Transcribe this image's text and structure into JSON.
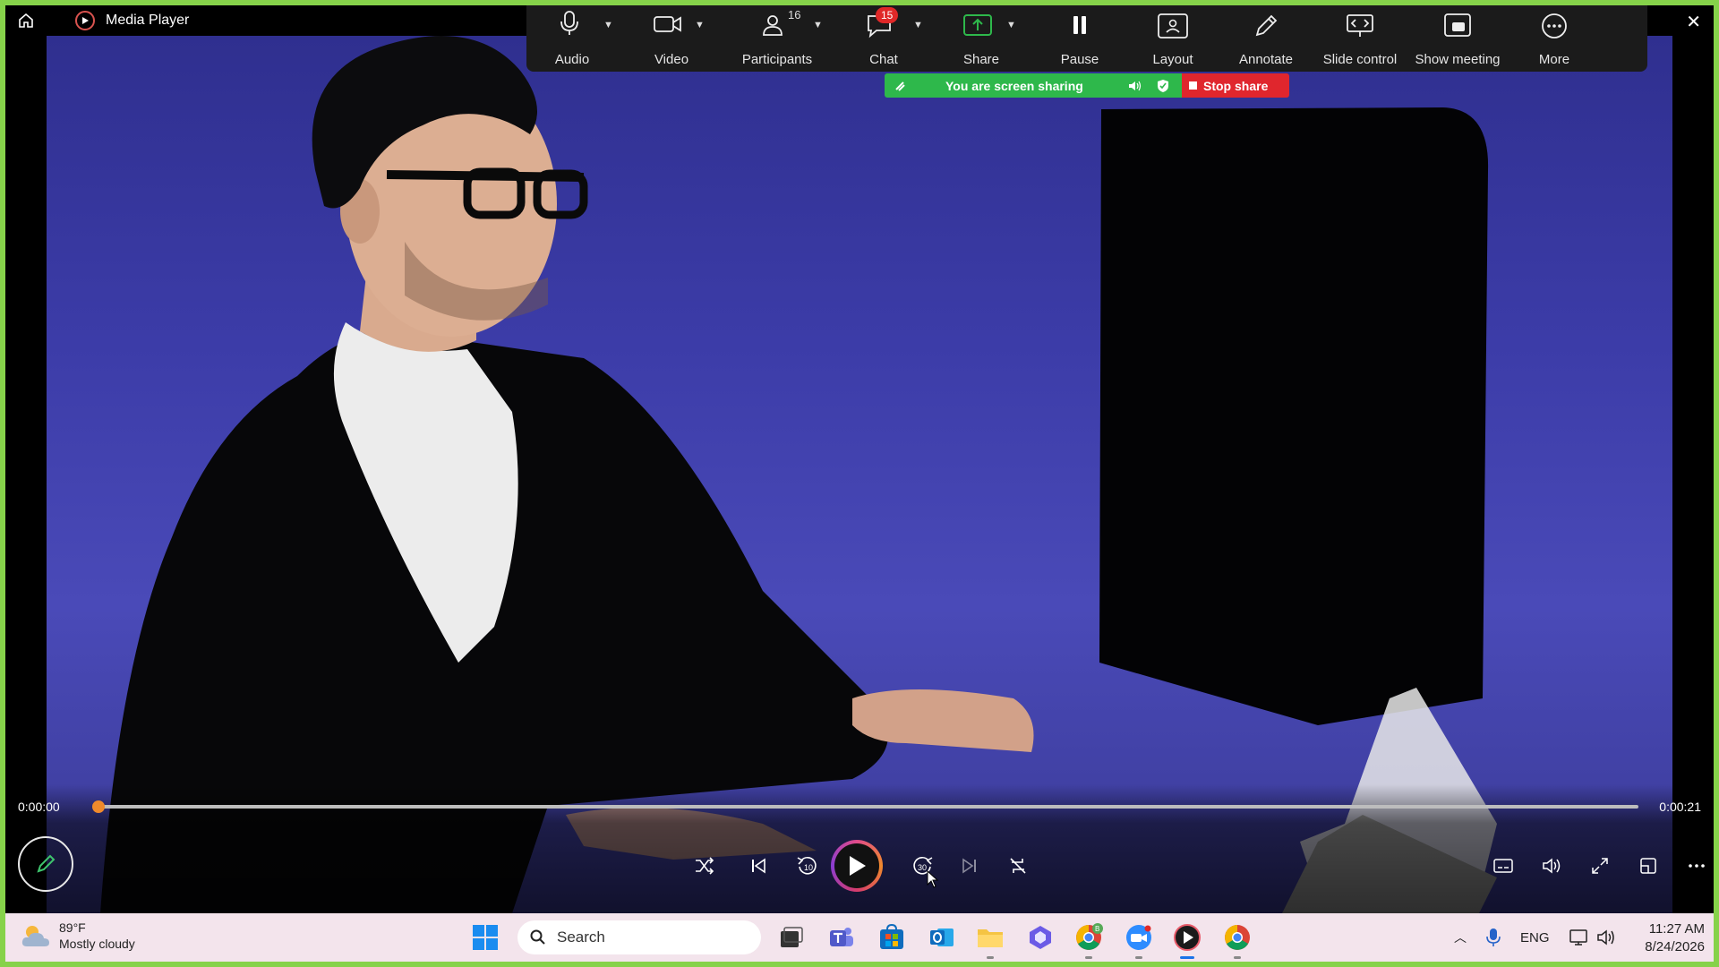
{
  "window": {
    "title": "Media Player"
  },
  "zoom_toolbar": {
    "items": [
      {
        "label": "Audio",
        "icon": "microphone-icon"
      },
      {
        "label": "Video",
        "icon": "video-camera-icon"
      },
      {
        "label": "Participants",
        "icon": "participants-icon",
        "count": "16"
      },
      {
        "label": "Chat",
        "icon": "chat-icon",
        "badge": "15"
      },
      {
        "label": "Share",
        "icon": "share-screen-icon"
      },
      {
        "label": "Pause",
        "icon": "pause-icon"
      },
      {
        "label": "Layout",
        "icon": "layout-icon"
      },
      {
        "label": "Annotate",
        "icon": "pencil-icon"
      },
      {
        "label": "Slide control",
        "icon": "slide-control-icon"
      },
      {
        "label": "Show meeting",
        "icon": "show-meeting-icon"
      },
      {
        "label": "More",
        "icon": "more-icon"
      }
    ]
  },
  "share_banner": {
    "status": "You are screen sharing",
    "stop_label": "Stop share",
    "status_color": "#2eb84b",
    "stop_color": "#e0262d"
  },
  "playback": {
    "current_time": "0:00:00",
    "total_time": "0:00:21",
    "progress_fraction": 0.0,
    "rewind_label": "10",
    "forward_label": "30",
    "accent": "#f08a2c"
  },
  "taskbar": {
    "weather": {
      "temp": "89°F",
      "condition": "Mostly cloudy"
    },
    "search_placeholder": "Search",
    "tray": {
      "language": "ENG"
    },
    "clock": {
      "time": "11:27 AM",
      "date": "8/24/2026"
    },
    "chrome_badge": "B"
  }
}
